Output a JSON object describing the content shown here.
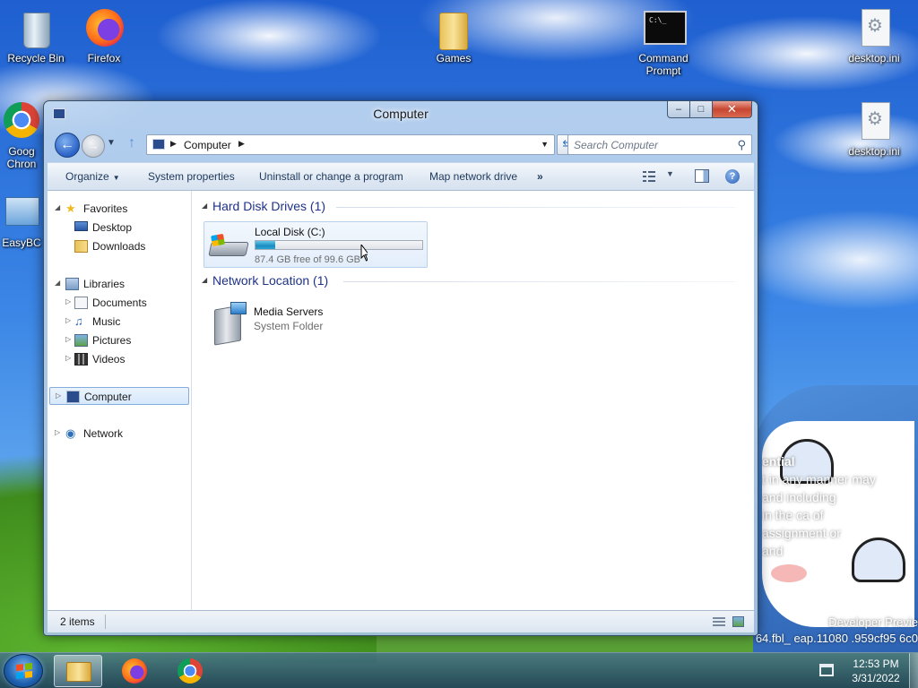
{
  "desktop": {
    "icons": [
      {
        "label": "Recycle Bin"
      },
      {
        "label": "Firefox"
      },
      {
        "label": "Games"
      },
      {
        "label": "Command Prompt"
      },
      {
        "label": "desktop.ini"
      },
      {
        "label": "desktop.ini"
      },
      {
        "label": "Goog Chron"
      },
      {
        "label": "EasyBC"
      }
    ],
    "watermark": {
      "title": "ential",
      "lines": [
        "t in any manner may",
        "and including",
        "in the ca   of",
        "assignment or",
        "      and"
      ]
    },
    "build_info": [
      "Developer Previe",
      "64.fbl_ eap.11080  .959cf95   6c0"
    ]
  },
  "window": {
    "title": "Computer",
    "caption": {
      "minimize": "–",
      "maximize": "□",
      "close": "✕"
    },
    "nav": {
      "back_icon": "back-arrow-icon",
      "forward_icon": "forward-arrow-icon",
      "up_icon": "up-arrow-icon",
      "address": "Computer",
      "search_placeholder": "Search Computer"
    },
    "toolbar": {
      "organize": "Organize",
      "system_properties": "System properties",
      "uninstall": "Uninstall or change a program",
      "map_drive": "Map network drive",
      "more": "»"
    },
    "nav_pane": {
      "favorites": "Favorites",
      "desktop": "Desktop",
      "downloads": "Downloads",
      "libraries": "Libraries",
      "documents": "Documents",
      "music": "Music",
      "pictures": "Pictures",
      "videos": "Videos",
      "computer": "Computer",
      "network": "Network"
    },
    "groups": {
      "hard_disk": "Hard Disk Drives (1)",
      "network_location": "Network Location (1)"
    },
    "drive": {
      "name": "Local Disk (C:)",
      "free_text": "87.4 GB free of 99.6 GB",
      "used_fraction": 0.12
    },
    "media": {
      "name": "Media Servers",
      "type": "System Folder"
    },
    "status": {
      "count": "2 items"
    }
  },
  "taskbar": {
    "time": "12:53 PM",
    "date": "3/31/2022"
  },
  "colors": {
    "group_header": "#1e3287",
    "selection_border": "#84acdd",
    "drive_bar": "#1b8cc0"
  }
}
